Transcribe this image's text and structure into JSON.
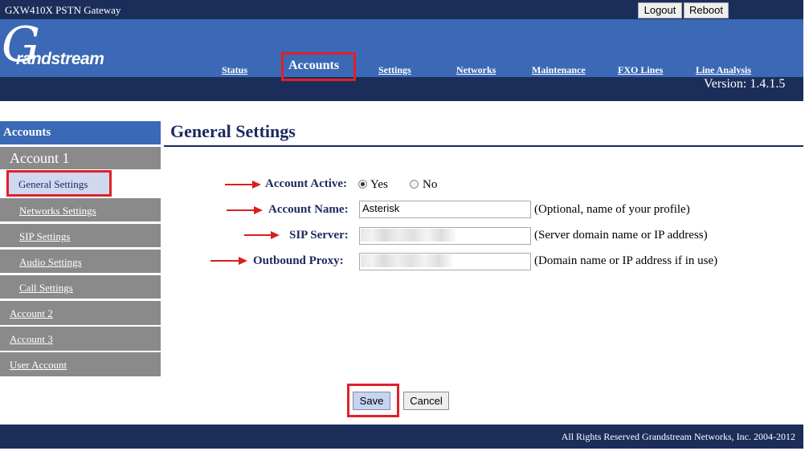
{
  "header": {
    "product": "GXW410X PSTN Gateway",
    "logout": "Logout",
    "reboot": "Reboot",
    "logo_initial": "G",
    "logo_text": "randstream",
    "version": "Version: 1.4.1.5"
  },
  "nav": {
    "status": "Status",
    "accounts": "Accounts",
    "settings": "Settings",
    "networks": "Networks",
    "maintenance": "Maintenance",
    "fxo_lines": "FXO Lines",
    "line_analysis": "Line Analysis"
  },
  "sidebar": {
    "title": "Accounts",
    "account1": "Account 1",
    "items": {
      "general": "General Settings",
      "networks": "Networks Settings",
      "sip": "SIP Settings",
      "audio": "Audio Settings",
      "call": "Call Settings"
    },
    "account2": "Account 2",
    "account3": "Account 3",
    "user_account": "User Account"
  },
  "main": {
    "title": "General Settings",
    "account_active": {
      "label": "Account Active:",
      "yes": "Yes",
      "no": "No",
      "selected": "Yes"
    },
    "account_name": {
      "label": "Account Name:",
      "value": "Asterisk",
      "hint": "(Optional, name of your profile)"
    },
    "sip_server": {
      "label": "SIP Server:",
      "hint": "(Server domain name or IP address)"
    },
    "outbound_proxy": {
      "label": "Outbound Proxy:",
      "hint": "(Domain name or IP address if in use)"
    },
    "save": "Save",
    "cancel": "Cancel"
  },
  "footer": {
    "copyright": "All Rights Reserved Grandstream Networks, Inc. 2004-2012"
  },
  "colors": {
    "navy": "#1b2e5a",
    "blue_band": "#3b69b5",
    "sidebar_gray": "#8a8a8a",
    "highlight_red": "#e0202a"
  }
}
